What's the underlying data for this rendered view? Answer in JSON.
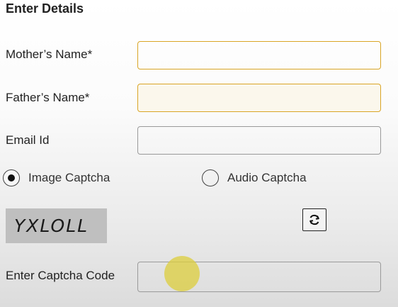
{
  "form": {
    "section_title": "Enter Details",
    "mother_name_label": "Mother’s Name*",
    "mother_name_value": "",
    "father_name_label": "Father’s Name*",
    "father_name_value": "",
    "email_label": "Email Id",
    "email_value": ""
  },
  "captcha": {
    "image_option_label": "Image Captcha",
    "audio_option_label": "Audio Captcha",
    "selected": "image",
    "image_text": "YXLOLL",
    "code_label": "Enter Captcha Code",
    "code_value": ""
  },
  "icons": {
    "refresh": "refresh-icon"
  },
  "colors": {
    "focus_border": "#d9a526",
    "default_border": "#9a9a9a",
    "captcha_bg": "#bfbfbf",
    "cursor_highlight": "#dccd3c"
  }
}
